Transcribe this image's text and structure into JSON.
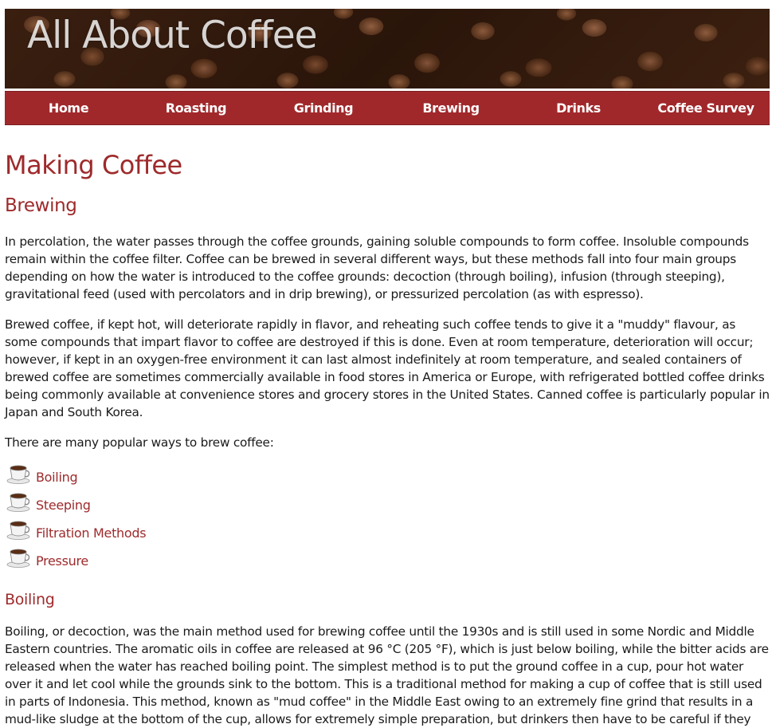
{
  "site": {
    "banner_title": "All About Coffee"
  },
  "nav": {
    "items": [
      "Home",
      "Roasting",
      "Grinding",
      "Brewing",
      "Drinks",
      "Coffee Survey"
    ]
  },
  "page": {
    "title": "Making Coffee",
    "section_title": "Brewing",
    "paragraphs": [
      "In percolation, the water passes through the coffee grounds, gaining soluble compounds to form coffee. Insoluble compounds remain within the coffee filter. Coffee can be brewed in several different ways, but these methods fall into four main groups depending on how the water is introduced to the coffee grounds: decoction (through boiling), infusion (through steeping), gravitational feed (used with percolators and in drip brewing), or pressurized percolation (as with espresso).",
      "Brewed coffee, if kept hot, will deteriorate rapidly in flavor, and reheating such coffee tends to give it a \"muddy\" flavour, as some compounds that impart flavor to coffee are destroyed if this is done. Even at room temperature, deterioration will occur; however, if kept in an oxygen-free environment it can last almost indefinitely at room temperature, and sealed containers of brewed coffee are sometimes commercially available in food stores in America or Europe, with refrigerated bottled coffee drinks being commonly available at convenience stores and grocery stores in the United States. Canned coffee is particularly popular in Japan and South Korea.",
      "There are many popular ways to brew coffee:"
    ],
    "methods": [
      "Boiling",
      "Steeping",
      "Filtration Methods",
      "Pressure"
    ],
    "boiling_title": "Boiling",
    "boiling_paragraph": "Boiling, or decoction, was the main method used for brewing coffee until the 1930s and is still used in some Nordic and Middle Eastern countries. The aromatic oils in coffee are released at 96 °C (205 °F), which is just below boiling, while the bitter acids are released when the water has reached boiling point. The simplest method is to put the ground coffee in a cup, pour hot water over it and let cool while the grounds sink to the bottom. This is a traditional method for making a cup of coffee that is still used in parts of Indonesia. This method, known as \"mud coffee\" in the Middle East owing to an extremely fine grind that results in a mud-like sludge at the bottom of the cup, allows for extremely simple preparation, but drinkers then have to be careful if they"
  },
  "colors": {
    "accent": "#9e2a2b",
    "nav_background": "#a0282b",
    "nav_text": "#ffffff",
    "body_text": "#1a1a1a"
  },
  "icons": {
    "list_bullet": "coffee-cup-icon"
  }
}
